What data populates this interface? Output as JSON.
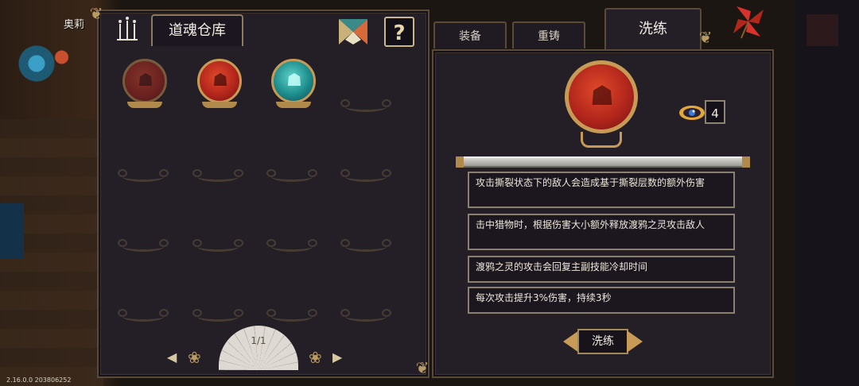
{
  "background": {
    "character_name": "奥莉"
  },
  "version": "2.16.0.0 203806252",
  "left_panel": {
    "title": "道魂仓库",
    "help_label": "?",
    "slots": [
      {
        "state": "orb",
        "color": "red",
        "dim": true
      },
      {
        "state": "orb",
        "color": "red",
        "dim": false
      },
      {
        "state": "orb",
        "color": "teal",
        "dim": false
      },
      {
        "state": "empty"
      },
      {
        "state": "empty"
      },
      {
        "state": "empty"
      },
      {
        "state": "empty"
      },
      {
        "state": "empty"
      },
      {
        "state": "empty"
      },
      {
        "state": "empty"
      },
      {
        "state": "empty"
      },
      {
        "state": "empty"
      },
      {
        "state": "empty"
      },
      {
        "state": "empty"
      },
      {
        "state": "empty"
      },
      {
        "state": "empty"
      }
    ],
    "pager": {
      "prev": "◀",
      "next": "▶",
      "page": "1/1"
    }
  },
  "tabs": {
    "equip": "装备",
    "recast": "重铸",
    "refine": "洗练",
    "active": "refine"
  },
  "refine": {
    "cost_value": "4",
    "effects": [
      "攻击撕裂状态下的敌人会造成基于撕裂层数的额外伤害",
      "击中猎物时，根据伤害大小额外释放渡鸦之灵攻击敌人",
      "渡鸦之灵的攻击会回复主副技能冷却时间",
      "每次攻击提升3%伤害，持续3秒"
    ],
    "button_label": "洗练"
  },
  "colors": {
    "accent_gold": "#c79b55",
    "orb_red": "#b3261c",
    "orb_teal": "#1d8c8c",
    "panel_bg": "#241e26"
  }
}
